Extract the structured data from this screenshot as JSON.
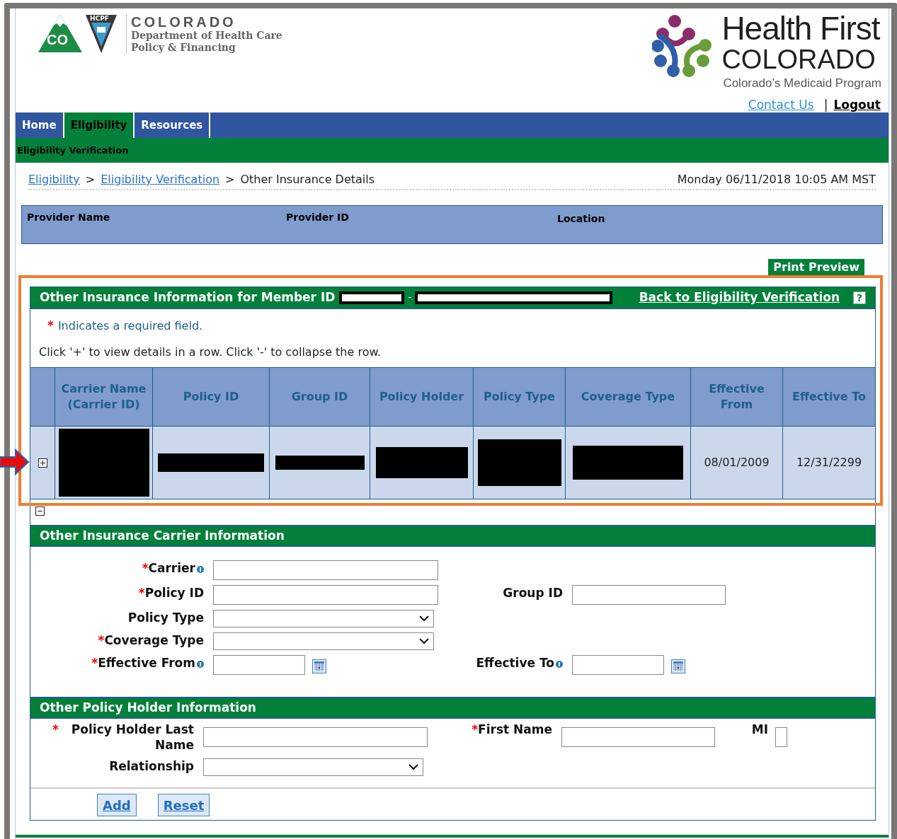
{
  "header": {
    "agency_logo": {
      "mark": "CO",
      "badge": "HCPF",
      "wordmark": "COLORADO",
      "subtitle_lines": [
        "Department of Health Care",
        "Policy & Financing"
      ]
    },
    "program_logo": {
      "title": "Health First",
      "subtitle": "COLORADO",
      "tagline": "Colorado’s Medicaid Program"
    },
    "links": [
      {
        "label": "Contact Us",
        "kind": "link"
      },
      {
        "label": "|",
        "kind": "separator"
      },
      {
        "label": "Logout",
        "kind": "strong"
      }
    ]
  },
  "nav": {
    "tabs": [
      {
        "label": "Home",
        "selected": false
      },
      {
        "label": "Eligibility",
        "selected": true
      },
      {
        "label": "Resources",
        "selected": false
      }
    ],
    "subtitle": "Eligibility Verification"
  },
  "breadcrumb": [
    {
      "label": "Eligibility",
      "kind": "link"
    },
    {
      "label": ">",
      "kind": "separator"
    },
    {
      "label": "Eligibility Verification",
      "kind": "link"
    },
    {
      "label": ">",
      "kind": "separator"
    },
    {
      "label": "Other Insurance Details",
      "kind": "current"
    }
  ],
  "datetime": "Monday 06/11/2018 10:05 AM MST",
  "provider_bar": {
    "columns": [
      "Provider Name",
      "Provider ID",
      "Location"
    ]
  },
  "print_button": "Print Preview",
  "panel": {
    "title": "Other Insurance Information for Member ID",
    "member_id_separator": "-",
    "back_link": "Back to Eligibility Verification",
    "help": "?",
    "required_mark": "*",
    "required_note": "Indicates a required field.",
    "instructions": "Click '+' to view details in a row. Click '-' to collapse the row.",
    "table": {
      "columns": [
        "",
        "Carrier Name (Carrier ID)",
        "Policy ID",
        "Group ID",
        "Policy Holder",
        "Policy Type",
        "Coverage Type",
        "Effective From",
        "Effective To"
      ],
      "rows": [
        {
          "cells": [
            {
              "kind": "toggle"
            },
            {
              "kind": "redacted"
            },
            {
              "kind": "redacted"
            },
            {
              "kind": "redacted"
            },
            {
              "kind": "redacted"
            },
            {
              "kind": "redacted"
            },
            {
              "kind": "redacted"
            },
            {
              "kind": "text",
              "text": "08/01/2009"
            },
            {
              "kind": "text",
              "text": "12/31/2299"
            }
          ]
        }
      ]
    },
    "sections": [
      {
        "title": "Other Insurance Carrier Information",
        "rows": [
          [
            {
              "label": "Carrier",
              "required": true,
              "info": true,
              "kind": "text"
            }
          ],
          [
            {
              "label": "Policy ID",
              "required": true,
              "info": false,
              "kind": "text"
            },
            {
              "label": "Group ID",
              "required": false,
              "info": false,
              "kind": "text"
            }
          ],
          [
            {
              "label": "Policy Type",
              "required": false,
              "info": false,
              "kind": "select"
            }
          ],
          [
            {
              "label": "Coverage Type",
              "required": true,
              "info": false,
              "kind": "select"
            }
          ],
          [
            {
              "label": "Effective From",
              "required": true,
              "info": true,
              "kind": "date"
            },
            {
              "label": "Effective To",
              "required": false,
              "info": true,
              "kind": "date"
            }
          ]
        ]
      },
      {
        "title": "Other Policy Holder Information",
        "rows": [
          [
            {
              "label": "Policy Holder Last Name",
              "required": true,
              "info": false,
              "kind": "text"
            },
            {
              "label": "First Name",
              "required": true,
              "info": false,
              "kind": "text"
            },
            {
              "label": "MI",
              "required": false,
              "info": false,
              "kind": "short"
            }
          ],
          [
            {
              "label": "Relationship",
              "required": false,
              "info": false,
              "kind": "select"
            }
          ]
        ]
      }
    ],
    "buttons": [
      "Add",
      "Reset"
    ]
  }
}
